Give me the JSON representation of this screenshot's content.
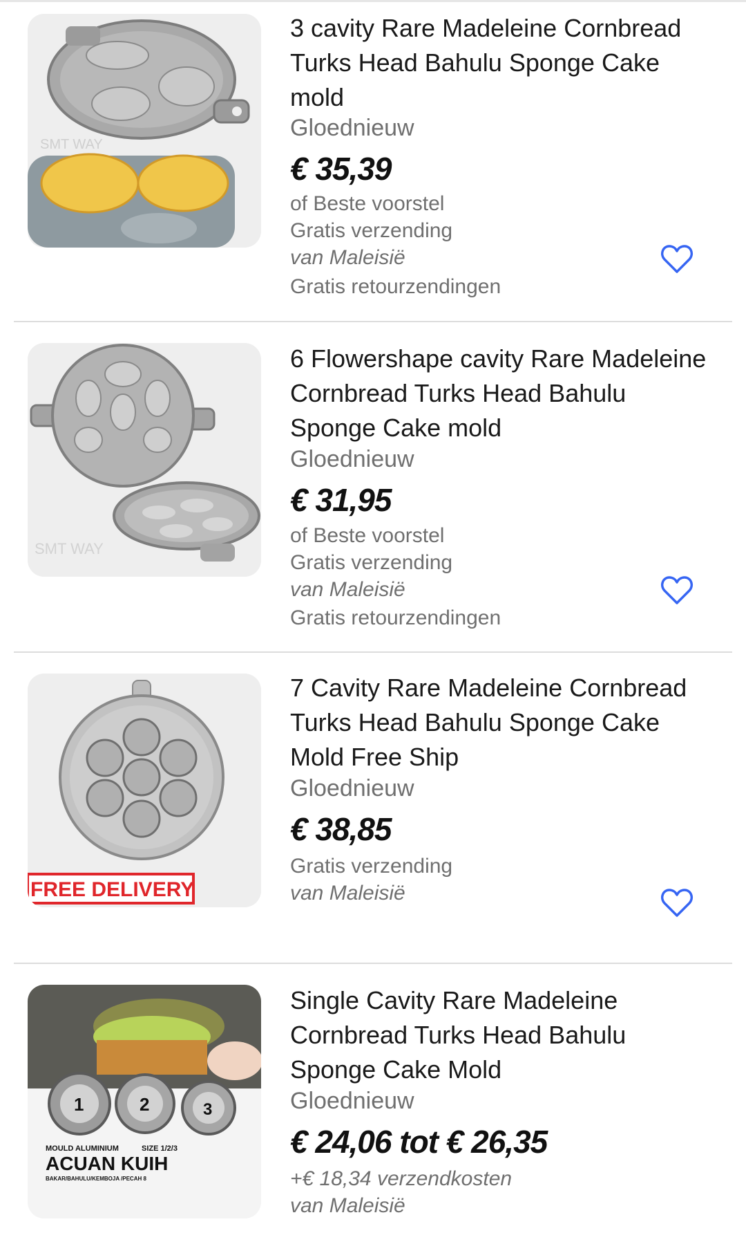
{
  "listings": [
    {
      "title": "3 cavity Rare Madeleine Cornbread Turks Head Bahulu Sponge Cake mold",
      "condition": "Gloednieuw",
      "price": "€ 35,39",
      "best_offer": "of Beste voorstel",
      "shipping": "Gratis verzending",
      "origin": "van Maleisië",
      "returns": "Gratis retourzendingen",
      "image_watermark": "SMT WAY"
    },
    {
      "title": "6 Flowershape cavity Rare Madeleine Cornbread Turks Head Bahulu Sponge Cake mold",
      "condition": "Gloednieuw",
      "price": "€ 31,95",
      "best_offer": "of Beste voorstel",
      "shipping": "Gratis verzending",
      "origin": "van Maleisië",
      "returns": "Gratis retourzendingen",
      "image_watermark": "SMT WAY"
    },
    {
      "title": "7 Cavity Rare Madeleine Cornbread Turks Head Bahulu Sponge Cake Mold Free Ship",
      "condition": "Gloednieuw",
      "price": "€ 38,85",
      "shipping": "Gratis verzending",
      "origin": "van Maleisië",
      "image_banner": "FREE DELIVERY"
    },
    {
      "title": "Single Cavity Rare Madeleine Cornbread Turks Head Bahulu Sponge Cake  Mold",
      "condition": "Gloednieuw",
      "price": "€ 24,06 tot € 26,35",
      "shipping": "+€ 18,34 verzendkosten",
      "origin": "van Maleisië",
      "image_text": {
        "line1": "MOULD ALUMINIUM",
        "line2": "SIZE 1/2/3",
        "line3": "ACUAN KUIH",
        "line4": "BAKAR/BAHULU/KEMBOJA /PECAH 8",
        "n1": "1",
        "n2": "2",
        "n3": "3"
      }
    }
  ],
  "icons": {
    "favorite": "heart-outline-icon"
  },
  "colors": {
    "heart": "#3665f3",
    "banner": "#e0262b"
  }
}
